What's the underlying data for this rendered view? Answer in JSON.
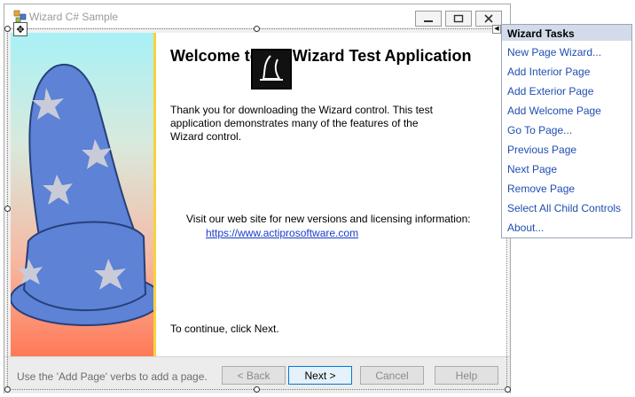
{
  "window": {
    "title": "Wizard C# Sample"
  },
  "page": {
    "title": "Welcome to the Wizard Test Application",
    "intro": "Thank you for downloading the Wizard control.  This test application demonstrates many of the features of the Wizard control.",
    "visit_text": "Visit our web site for new versions and licensing information:",
    "link": "https://www.actiprosoftware.com",
    "continue_text": "To continue, click Next."
  },
  "bottom_bar": {
    "status": "Use the 'Add Page' verbs to add a page.",
    "back": "< Back",
    "next": "Next >",
    "cancel": "Cancel",
    "help": "Help"
  },
  "tasks": {
    "header": "Wizard Tasks",
    "items": [
      "New Page Wizard...",
      "Add Interior Page",
      "Add Exterior Page",
      "Add Welcome Page",
      "Go To Page...",
      "Previous Page",
      "Next Page",
      "Remove Page",
      "Select All Child Controls",
      "About..."
    ]
  },
  "icons": {
    "window": "app-icon",
    "minimize": "minimize-icon",
    "maximize": "maximize-icon",
    "close": "close-icon",
    "move": "move-icon",
    "smart_tag": "smart-tag-arrow-icon",
    "logo": "wizard-hat-logo-icon"
  },
  "colors": {
    "link": "#1a3cc8",
    "accent_divider": "#f7d23b",
    "task_link": "#1f4eb0",
    "task_header_bg": "#d3dbea"
  }
}
